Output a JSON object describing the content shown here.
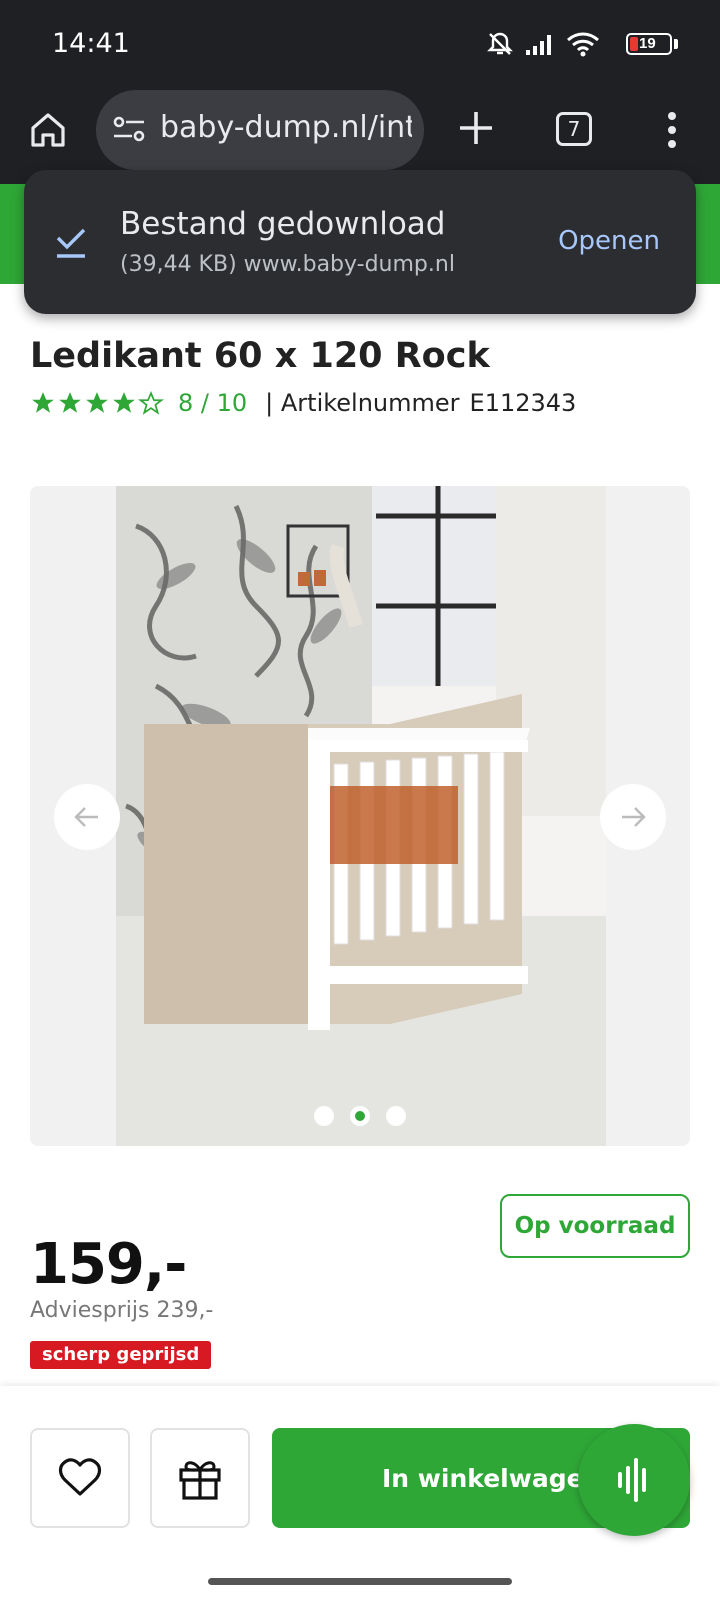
{
  "status_bar": {
    "time": "14:41",
    "battery_level": "19",
    "icons": [
      "mute-icon",
      "signal-icon",
      "wifi-icon",
      "battery-icon"
    ]
  },
  "browser": {
    "url": "baby-dump.nl/int",
    "tab_count": "7"
  },
  "download_snackbar": {
    "title": "Bestand gedownload",
    "detail": "(39,44 KB) www.baby-dump.nl",
    "action": "Openen"
  },
  "product": {
    "title": "Ledikant 60 x 120 Rock",
    "rating_score": "8 / 10",
    "stars_filled": 4,
    "stars_total": 5,
    "article_label": "| Artikelnummer",
    "article_number": "E112343",
    "gallery": {
      "slide_count": 3,
      "active_slide": 2
    },
    "stock_status": "Op voorraad",
    "price": "159,-",
    "advice_price": "Adviesprijs 239,-",
    "promo_label": "scherp geprijsd"
  },
  "actions": {
    "add_to_cart": "In winkelwagen"
  },
  "colors": {
    "brand_green": "#2fa737",
    "promo_red": "#d71921",
    "chrome_dark": "#1f2024",
    "snackbar_action": "#a8c7fa"
  }
}
